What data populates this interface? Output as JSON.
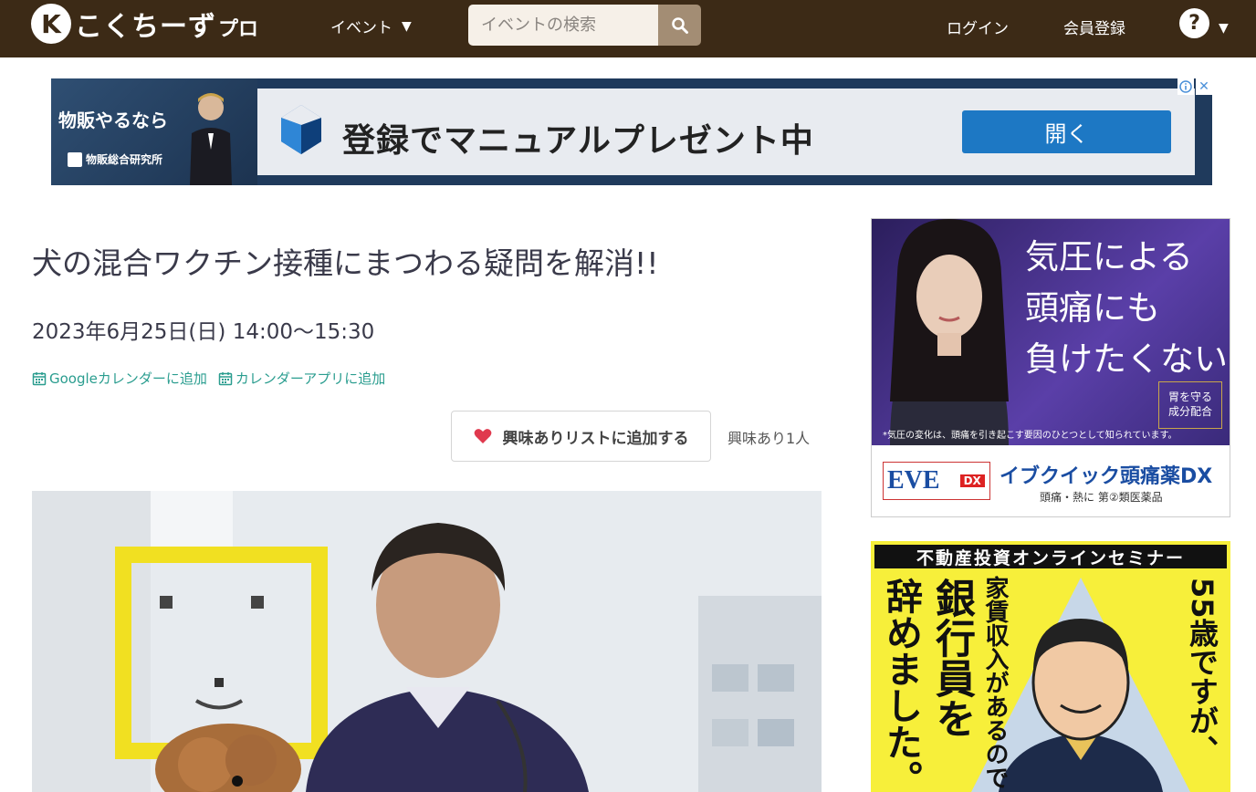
{
  "header": {
    "logo_badge": "K",
    "logo_text": "こくちーず",
    "logo_pro": "プロ",
    "nav_event_label": "イベント",
    "search_placeholder": "イベントの検索",
    "login_label": "ログイン",
    "register_label": "会員登録",
    "help_label": "?"
  },
  "top_ad": {
    "left_title": "物販やるなら",
    "left_brand": "物販総合研究所",
    "headline": "登録でマニュアルプレゼント中",
    "open_button": "開く",
    "close_label": "✕"
  },
  "event": {
    "title": "犬の混合ワクチン接種にまつわる疑問を解消!!",
    "datetime": "2023年6月25日(日) 14:00〜15:30",
    "calendar_links": [
      {
        "label": "Googleカレンダーに追加"
      },
      {
        "label": "カレンダーアプリに追加"
      }
    ],
    "interest_button": "興味ありリストに追加する",
    "interest_count": "興味あり1人"
  },
  "side_ads": {
    "ad1": {
      "headline": "気圧による\n頭痛にも\n負けたくない",
      "note": "*気圧の変化は、頭痛を引き起こす要因のひとつとして知られています。",
      "badge": "胃を守る\n成分配合",
      "brand": "EVE",
      "brand_tag": "DX",
      "product": "イブクイック頭痛薬DX",
      "sub": "頭痛・熱に 第②類医薬品"
    },
    "ad2": {
      "header": "不動産投資オンラインセミナー",
      "col_left": "辞めました。",
      "col_bank": "銀行員を",
      "col_rent": "家賃収入があるので",
      "col_age": "55歳ですが、"
    }
  },
  "colors": {
    "header_bg": "#3c2a16",
    "search_btn": "#a38d74",
    "link_teal": "#2a9d8f",
    "heart": "#e0394e",
    "open_button": "#1d78c4"
  }
}
